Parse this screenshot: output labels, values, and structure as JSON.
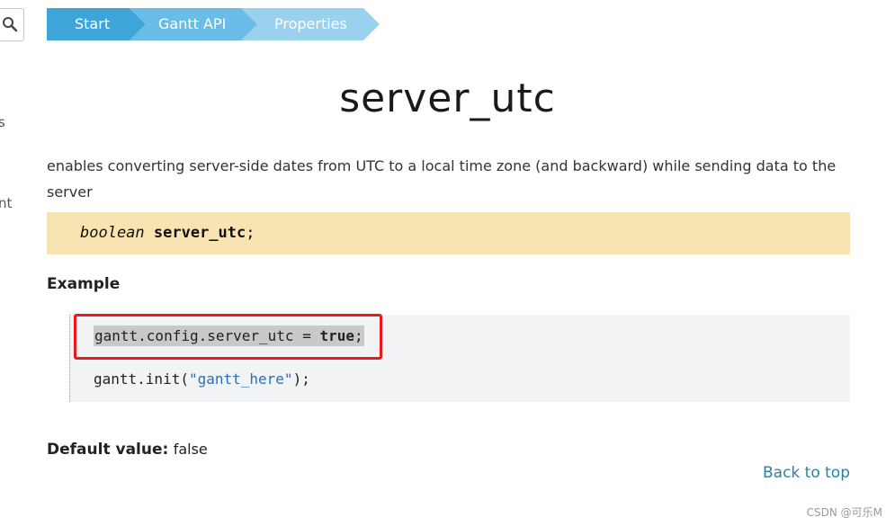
{
  "sidebar": {
    "search_icon": "search-icon",
    "fragment_1": "s",
    "fragment_2": "nt"
  },
  "breadcrumbs": [
    {
      "label": "Start"
    },
    {
      "label": "Gantt API"
    },
    {
      "label": "Properties"
    }
  ],
  "page": {
    "title": "server_utc",
    "description": "enables converting server-side dates from UTC to a local time zone (and backward) while sending data to the server",
    "signature": {
      "type": "boolean",
      "name": "server_utc",
      "terminator": ";"
    }
  },
  "example": {
    "heading": "Example",
    "line1": {
      "prefix": "gantt.config.server_utc = ",
      "keyword": "true",
      "suffix": ";"
    },
    "line2": {
      "prefix": "gantt.init(",
      "string": "\"gantt_here\"",
      "suffix": ");"
    }
  },
  "default_value": {
    "label": "Default value:",
    "value": "false"
  },
  "back_to_top": "Back to top",
  "watermark": "CSDN @可乐M",
  "colors": {
    "breadcrumb_1": "#3ea5d9",
    "breadcrumb_2": "#69bde6",
    "breadcrumb_3": "#99d1ee",
    "signature_bg": "#f8e4b0",
    "highlight": "#e8191f",
    "link": "#2e7fa8"
  }
}
